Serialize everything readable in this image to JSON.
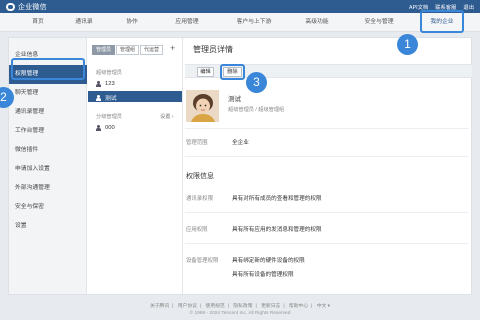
{
  "app": {
    "title": "企业微信",
    "top_links": [
      "API文档",
      "联系客服",
      "退出"
    ]
  },
  "nav": {
    "items": [
      "首页",
      "通讯录",
      "协作",
      "应用管理",
      "客户与上下游",
      "高级功能",
      "安全与管理",
      "我的企业"
    ],
    "active_index": 7
  },
  "sidebar": {
    "items": [
      "企业信息",
      "权限管理",
      "聊天管理",
      "通讯录管理",
      "工作台管理",
      "微信插件",
      "申请加入设置",
      "外部沟通管理",
      "安全与保密",
      "设置"
    ],
    "active_index": 1
  },
  "admin_list": {
    "tabs": [
      "管理员",
      "管理组",
      "代运营"
    ],
    "active_tab": 0,
    "add_label": "+",
    "super_admin_label": "超级管理员",
    "super_admins": [
      "123",
      "测试"
    ],
    "selected_member": "测试",
    "group_admin_label": "分级管理员",
    "settings_label": "设置 ›",
    "group_admins": [
      "000"
    ]
  },
  "detail": {
    "title": "管理员详情",
    "edit_label": "编辑",
    "delete_label": "删除",
    "name": "测试",
    "role": "超级管理员 / 超级管理组",
    "scope_label": "管理范围",
    "scope_value": "全企业",
    "perm_section": "权限信息",
    "perms": [
      {
        "label": "通讯录权限",
        "value": "具有对所有成员的查看和管理的权限"
      },
      {
        "label": "应用权限",
        "value": "具有所有应用的发消息和管理的权限"
      },
      {
        "label": "设备管理权限",
        "value": "具有绑定新的硬件设备的权限"
      }
    ],
    "extra_perm": "具有所有设备的管理权限"
  },
  "callouts": [
    "1",
    "2",
    "3"
  ],
  "footer": {
    "links": [
      "关于腾讯",
      "用户协议",
      "使用规范",
      "隐私政策",
      "更新日志",
      "帮助中心",
      "中文 ▾"
    ],
    "copyright": "© 1998 - 2024 Tencent Inc. All Rights Reserved"
  },
  "colors": {
    "brand": "#2e5c91",
    "highlight": "#3a86d8"
  }
}
